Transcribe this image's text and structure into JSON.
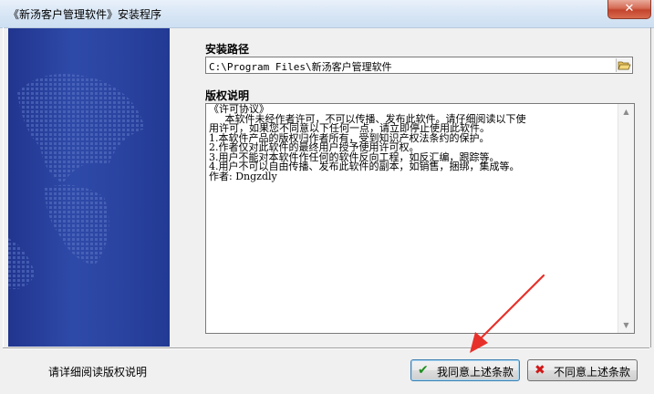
{
  "window": {
    "title": "《新汤客户管理软件》安装程序",
    "close_symbol": "✕"
  },
  "install_path": {
    "label": "安装路径",
    "value": "C:\\Program Files\\新汤客户管理软件"
  },
  "license": {
    "label": "版权说明",
    "lines": [
      "《许可协议》",
      "     本软件未经作者许可，不可以传播、发布此软件。请仔细阅读以下使",
      "用许可，如果您不同意以下任何一点，请立即停止使用此软件。",
      "1.本软件产品的版权归作者所有，受到知识产权法条约的保护。",
      "2.作者仅对此软件的最终用户授予使用许可权。",
      "3.用户不能对本软件作任何的软件反向工程，如反汇编，跟踪等。",
      "4.用户不可以自由传播、发布此软件的副本，如销售，捆绑，集成等。",
      "作者: Dngzdly"
    ]
  },
  "footer": {
    "hint": "请详细阅读版权说明",
    "agree_label": "我同意上述条款",
    "disagree_label": "不同意上述条款"
  },
  "colors": {
    "side_panel": "#2a43a0",
    "annotation_arrow": "#e8302a"
  },
  "icons": {
    "browse": "folder-open-icon",
    "agree": "check-icon",
    "disagree": "x-icon"
  }
}
